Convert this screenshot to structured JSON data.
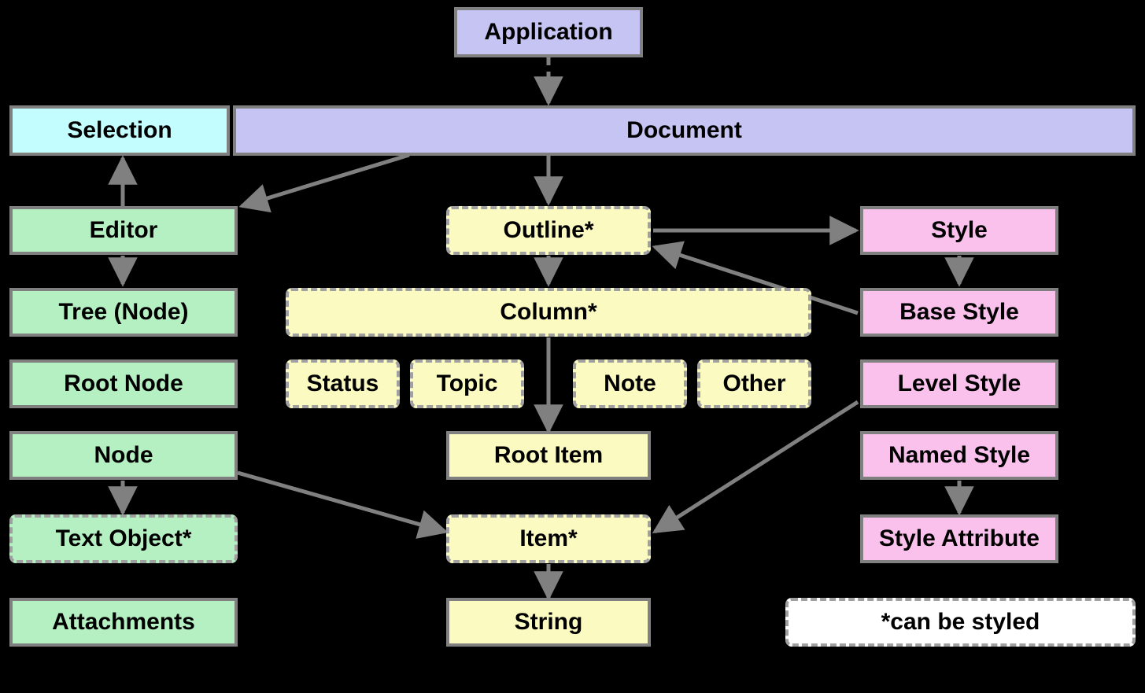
{
  "colors": {
    "purple": "#c5c4f2",
    "cyan": "#c3fdfd",
    "green": "#b4f0c1",
    "yellow": "#fbfac0",
    "pink": "#fac1ed",
    "white": "#ffffff",
    "border": "#808080",
    "dash": "#a0a0a0",
    "bg": "#000000"
  },
  "legend": {
    "text": "*can be styled"
  },
  "nodes": {
    "application": {
      "label": "Application",
      "color": "purple",
      "border": "solid"
    },
    "selection": {
      "label": "Selection",
      "color": "cyan",
      "border": "solid"
    },
    "document": {
      "label": "Document",
      "color": "purple",
      "border": "solid"
    },
    "editor": {
      "label": "Editor",
      "color": "green",
      "border": "solid"
    },
    "tree_node": {
      "label": "Tree (Node)",
      "color": "green",
      "border": "solid"
    },
    "root_node": {
      "label": "Root Node",
      "color": "green",
      "border": "solid"
    },
    "node": {
      "label": "Node",
      "color": "green",
      "border": "solid"
    },
    "text_object": {
      "label": "Text Object*",
      "color": "green",
      "border": "dashed"
    },
    "attachments": {
      "label": "Attachments",
      "color": "green",
      "border": "solid"
    },
    "outline": {
      "label": "Outline*",
      "color": "yellow",
      "border": "dashed"
    },
    "column": {
      "label": "Column*",
      "color": "yellow",
      "border": "dashed"
    },
    "status": {
      "label": "Status",
      "color": "yellow",
      "border": "dashed"
    },
    "topic": {
      "label": "Topic",
      "color": "yellow",
      "border": "dashed"
    },
    "note": {
      "label": "Note",
      "color": "yellow",
      "border": "dashed"
    },
    "other": {
      "label": "Other",
      "color": "yellow",
      "border": "dashed"
    },
    "root_item": {
      "label": "Root Item",
      "color": "yellow",
      "border": "solid"
    },
    "item": {
      "label": "Item*",
      "color": "yellow",
      "border": "dashed"
    },
    "string": {
      "label": "String",
      "color": "yellow",
      "border": "solid"
    },
    "style": {
      "label": "Style",
      "color": "pink",
      "border": "solid"
    },
    "base_style": {
      "label": "Base Style",
      "color": "pink",
      "border": "solid"
    },
    "level_style": {
      "label": "Level Style",
      "color": "pink",
      "border": "solid"
    },
    "named_style": {
      "label": "Named Style",
      "color": "pink",
      "border": "solid"
    },
    "style_attribute": {
      "label": "Style Attribute",
      "color": "pink",
      "border": "solid"
    }
  },
  "edges": [
    {
      "from": "application",
      "to": "document",
      "style": "dashed"
    },
    {
      "from": "document",
      "to": "outline",
      "style": "solid"
    },
    {
      "from": "document",
      "to": "editor",
      "style": "solid"
    },
    {
      "from": "editor",
      "to": "selection",
      "style": "solid"
    },
    {
      "from": "editor",
      "to": "tree_node",
      "style": "solid"
    },
    {
      "from": "node",
      "to": "text_object",
      "style": "solid"
    },
    {
      "from": "outline",
      "to": "column",
      "style": "solid"
    },
    {
      "from": "outline",
      "to": "style",
      "style": "solid"
    },
    {
      "from": "column",
      "to": "root_item",
      "style": "solid",
      "note": "passes through status/topic/note/other row"
    },
    {
      "from": "item",
      "to": "string",
      "style": "solid"
    },
    {
      "from": "node",
      "to": "item",
      "style": "solid"
    },
    {
      "from": "level_style",
      "to": "item",
      "style": "solid"
    },
    {
      "from": "base_style",
      "to": "outline",
      "style": "solid"
    },
    {
      "from": "style",
      "to": "base_style",
      "style": "solid"
    },
    {
      "from": "named_style",
      "to": "style_attribute",
      "style": "solid"
    }
  ]
}
